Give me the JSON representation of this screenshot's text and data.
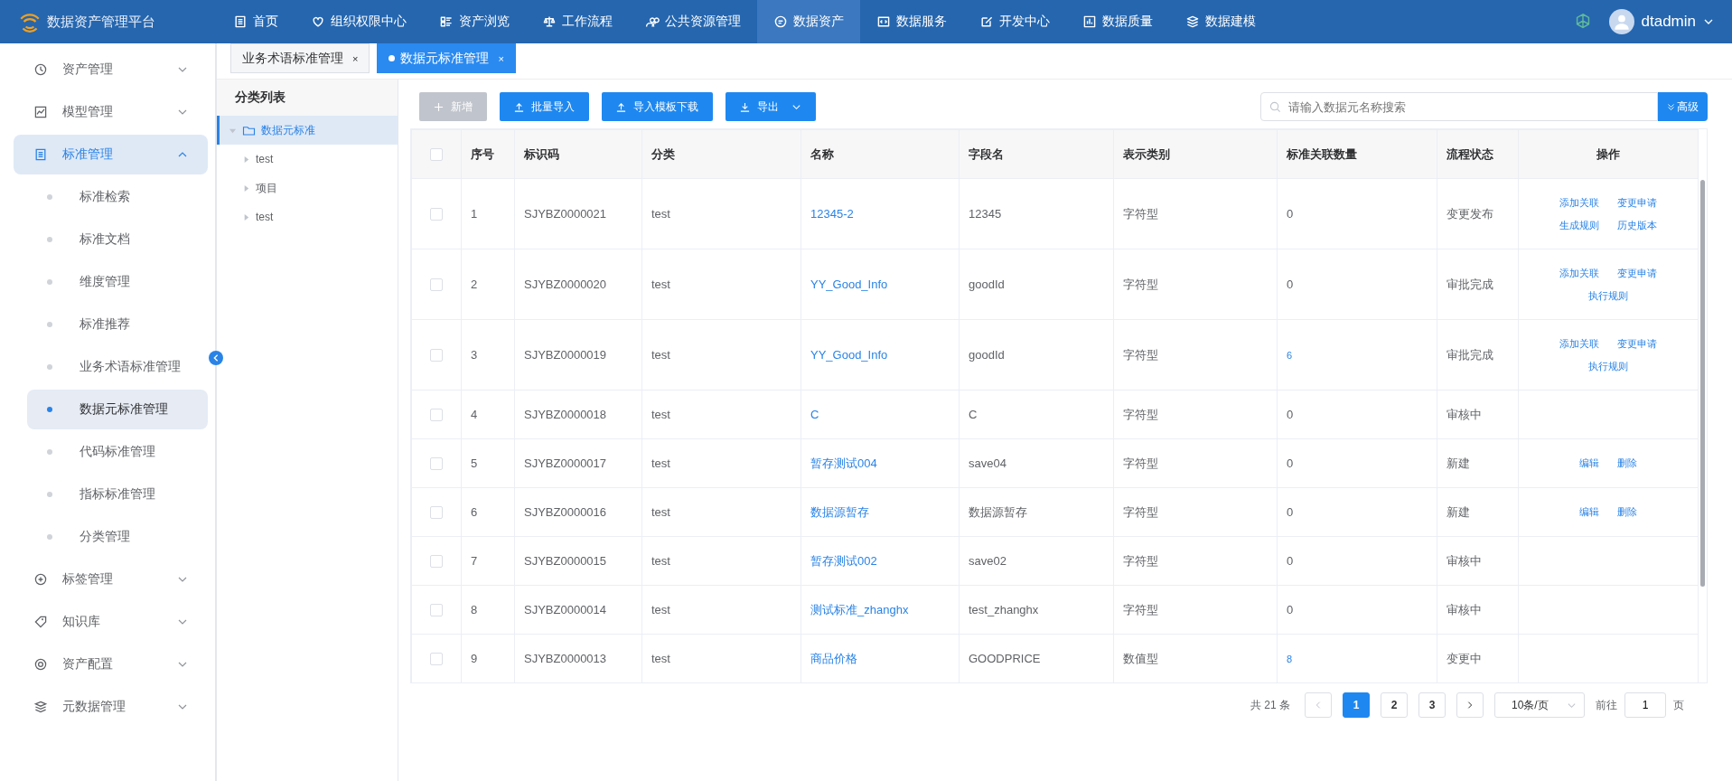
{
  "app": {
    "title": "数据资产管理平台",
    "user": "dtadmin"
  },
  "topnav": [
    {
      "label": "首页",
      "selected": false
    },
    {
      "label": "组织权限中心",
      "selected": false
    },
    {
      "label": "资产浏览",
      "selected": false
    },
    {
      "label": "工作流程",
      "selected": false
    },
    {
      "label": "公共资源管理",
      "selected": false
    },
    {
      "label": "数据资产",
      "selected": true
    },
    {
      "label": "数据服务",
      "selected": false
    },
    {
      "label": "开发中心",
      "selected": false
    },
    {
      "label": "数据质量",
      "selected": false
    },
    {
      "label": "数据建模",
      "selected": false
    }
  ],
  "sidebar": {
    "items": [
      {
        "label": "资产管理",
        "expanded": false
      },
      {
        "label": "模型管理",
        "expanded": false
      },
      {
        "label": "标准管理",
        "expanded": true,
        "children": [
          {
            "label": "标准检索",
            "selected": false
          },
          {
            "label": "标准文档",
            "selected": false
          },
          {
            "label": "维度管理",
            "selected": false
          },
          {
            "label": "标准推荐",
            "selected": false
          },
          {
            "label": "业务术语标准管理",
            "selected": false
          },
          {
            "label": "数据元标准管理",
            "selected": true
          },
          {
            "label": "代码标准管理",
            "selected": false
          },
          {
            "label": "指标标准管理",
            "selected": false
          },
          {
            "label": "分类管理",
            "selected": false
          }
        ]
      },
      {
        "label": "标签管理",
        "expanded": false
      },
      {
        "label": "知识库",
        "expanded": false
      },
      {
        "label": "资产配置",
        "expanded": false
      },
      {
        "label": "元数据管理",
        "expanded": false
      }
    ]
  },
  "tabs": [
    {
      "label": "业务术语标准管理",
      "selected": false,
      "close": "×"
    },
    {
      "label": "数据元标准管理",
      "selected": true,
      "close": "×"
    }
  ],
  "category_tree": {
    "title": "分类列表",
    "root": {
      "label": "数据元标准",
      "selected": true,
      "expanded": true,
      "children": [
        {
          "label": "test",
          "selected": false
        },
        {
          "label": "项目",
          "selected": false
        },
        {
          "label": "test",
          "selected": false
        }
      ]
    }
  },
  "toolbar": {
    "buttons": [
      {
        "label": "新增",
        "kind": "add",
        "disabled": true
      },
      {
        "label": "批量导入",
        "kind": "upload",
        "disabled": false
      },
      {
        "label": "导入模板下载",
        "kind": "upload",
        "disabled": false
      },
      {
        "label": "导出",
        "kind": "export",
        "disabled": false
      }
    ],
    "search": {
      "placeholder": "请输入数据元名称搜索"
    },
    "advanced": "高级"
  },
  "table": {
    "select_all_checked": false,
    "columns": [
      "序号",
      "标识码",
      "分类",
      "名称",
      "字段名",
      "表示类别",
      "标准关联数量",
      "流程状态",
      "操作"
    ],
    "rows": [
      {
        "checked": false,
        "no": "1",
        "code": "SJYBZ0000021",
        "category": "test",
        "name": "12345-2",
        "field": "12345",
        "type": "字符型",
        "count": "0",
        "count_linked": false,
        "status": "变更发布",
        "actions": [
          "添加关联",
          "变更申请",
          "生成规则",
          "历史版本"
        ]
      },
      {
        "checked": false,
        "no": "2",
        "code": "SJYBZ0000020",
        "category": "test",
        "name": "YY_Good_Info",
        "field": "goodId",
        "type": "字符型",
        "count": "0",
        "count_linked": false,
        "status": "审批完成",
        "actions": [
          "添加关联",
          "变更申请",
          "执行规则"
        ]
      },
      {
        "checked": false,
        "no": "3",
        "code": "SJYBZ0000019",
        "category": "test",
        "name": "YY_Good_Info",
        "field": "goodId",
        "type": "字符型",
        "count": "6",
        "count_linked": true,
        "status": "审批完成",
        "actions": [
          "添加关联",
          "变更申请",
          "执行规则"
        ]
      },
      {
        "checked": false,
        "no": "4",
        "code": "SJYBZ0000018",
        "category": "test",
        "name": "C",
        "field": "C",
        "type": "字符型",
        "count": "0",
        "count_linked": false,
        "status": "审核中"
      },
      {
        "checked": false,
        "no": "5",
        "code": "SJYBZ0000017",
        "category": "test",
        "name": "暂存测试004",
        "field": "save04",
        "type": "字符型",
        "count": "0",
        "count_linked": false,
        "status": "新建",
        "actions": [
          "编辑",
          "删除"
        ]
      },
      {
        "checked": false,
        "no": "6",
        "code": "SJYBZ0000016",
        "category": "test",
        "name": "数据源暂存",
        "field": "数据源暂存",
        "type": "字符型",
        "count": "0",
        "count_linked": false,
        "status": "新建",
        "actions": [
          "编辑",
          "删除"
        ]
      },
      {
        "checked": false,
        "no": "7",
        "code": "SJYBZ0000015",
        "category": "test",
        "name": "暂存测试002",
        "field": "save02",
        "type": "字符型",
        "count": "0",
        "count_linked": false,
        "status": "审核中"
      },
      {
        "checked": false,
        "no": "8",
        "code": "SJYBZ0000014",
        "category": "test",
        "name": "测试标准_zhanghx",
        "field": "test_zhanghx",
        "type": "字符型",
        "count": "0",
        "count_linked": false,
        "status": "审核中"
      },
      {
        "checked": false,
        "no": "9",
        "code": "SJYBZ0000013",
        "category": "test",
        "name": "商品价格",
        "field": "GOODPRICE",
        "type": "数值型",
        "count": "8",
        "count_linked": true,
        "status": "变更中"
      }
    ]
  },
  "pagination": {
    "total": "共 21 条",
    "pages": [
      {
        "label": "1",
        "selected": true
      },
      {
        "label": "2",
        "selected": false
      },
      {
        "label": "3",
        "selected": false
      }
    ],
    "page_size": "10条/页",
    "goto_label": "前往",
    "goto_value": "1",
    "goto_suffix": "页"
  }
}
